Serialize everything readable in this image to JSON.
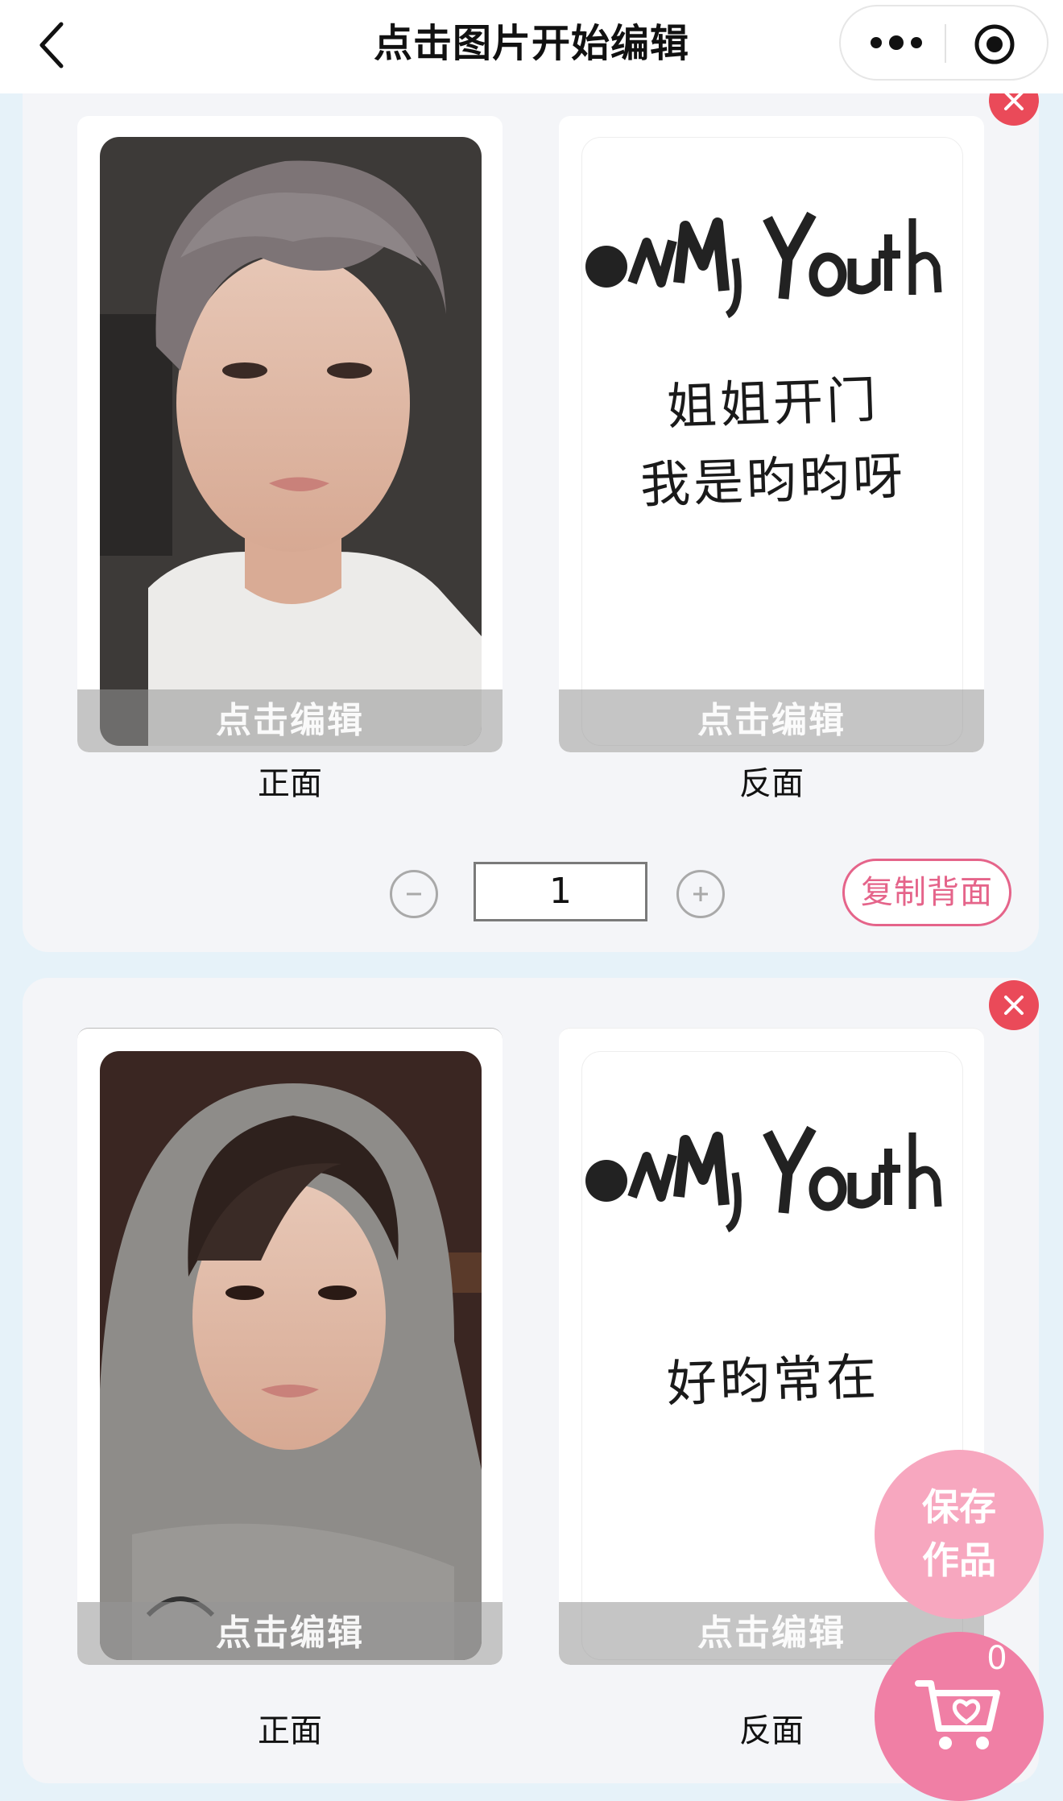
{
  "header": {
    "title": "点击图片开始编辑",
    "back_icon": "chevron-left-icon",
    "more_icon": "more-dots-icon",
    "target_icon": "target-circle-icon"
  },
  "cards": [
    {
      "front_edit": "点击编辑",
      "back_edit": "点击编辑",
      "front_label": "正面",
      "back_label": "反面",
      "back_logo": "OnMyYouth",
      "back_lines": [
        "姐姐开门",
        "我是昀昀呀"
      ],
      "quantity": "1",
      "copy_back_label": "复制背面"
    },
    {
      "front_edit": "点击编辑",
      "back_edit": "点击编辑",
      "front_label": "正面",
      "back_label": "反面",
      "back_logo": "OnMyYouth",
      "back_lines": [
        "好昀常在"
      ]
    }
  ],
  "fab": {
    "save_line1": "保存",
    "save_line2": "作品",
    "cart_count": "0",
    "cart_icon": "shopping-cart-heart-icon"
  },
  "colors": {
    "background": "#e6f2f9",
    "card": "#f4f5f8",
    "close": "#ea4a59",
    "accent_pink": "#e5648a",
    "save_fab": "#f7a7bf",
    "cart_fab": "#f07fa5"
  }
}
